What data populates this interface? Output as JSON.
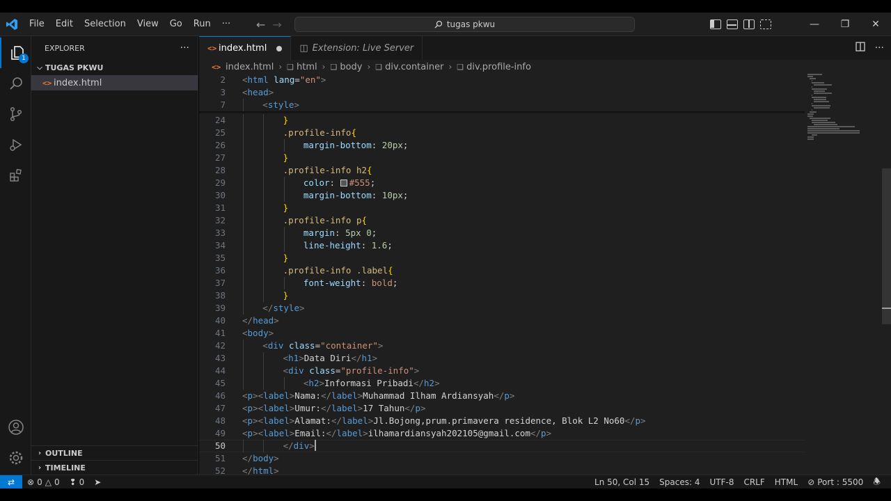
{
  "menu": [
    "File",
    "Edit",
    "Selection",
    "View",
    "Go",
    "Run",
    "···"
  ],
  "command_center": "tugas pkwu",
  "explorer": {
    "title": "EXPLORER",
    "folder": "TUGAS PKWU",
    "file": "index.html",
    "outline": "OUTLINE",
    "timeline": "TIMELINE",
    "badge": "1"
  },
  "tabs": [
    {
      "label": "index.html",
      "icon": "<>",
      "dirty": true
    },
    {
      "label": "Extension: Live Server"
    }
  ],
  "breadcrumbs": [
    "index.html",
    "html",
    "body",
    "div.container",
    "div.profile-info"
  ],
  "code": {
    "sticky": [
      {
        "n": "2",
        "indent": 0,
        "toks": [
          [
            "br",
            "<"
          ],
          [
            "tag",
            "html"
          ],
          [
            "txt",
            " "
          ],
          [
            "attr",
            "lang"
          ],
          [
            "txt",
            "="
          ],
          [
            "str",
            "\"en\""
          ],
          [
            "br",
            ">"
          ]
        ]
      },
      {
        "n": "3",
        "indent": 0,
        "toks": [
          [
            "br",
            "<"
          ],
          [
            "tag",
            "head"
          ],
          [
            "br",
            ">"
          ]
        ]
      },
      {
        "n": "7",
        "indent": 1,
        "toks": [
          [
            "br",
            "<"
          ],
          [
            "tag",
            "style"
          ],
          [
            "br",
            ">"
          ]
        ]
      }
    ],
    "lines": [
      {
        "n": "24",
        "indent": 2,
        "toks": [
          [
            "y",
            "}"
          ]
        ]
      },
      {
        "n": "25",
        "indent": 2,
        "toks": [
          [
            "sel",
            ".profile-info"
          ],
          [
            "y",
            "{"
          ]
        ]
      },
      {
        "n": "26",
        "indent": 3,
        "toks": [
          [
            "prop",
            "margin-bottom"
          ],
          [
            "txt",
            ": "
          ],
          [
            "num",
            "20px"
          ],
          [
            "txt",
            ";"
          ]
        ]
      },
      {
        "n": "27",
        "indent": 2,
        "toks": [
          [
            "y",
            "}"
          ]
        ]
      },
      {
        "n": "28",
        "indent": 2,
        "toks": [
          [
            "sel",
            ".profile-info h2"
          ],
          [
            "y",
            "{"
          ]
        ]
      },
      {
        "n": "29",
        "indent": 3,
        "toks": [
          [
            "prop",
            "color"
          ],
          [
            "txt",
            ": "
          ],
          [
            "swatch",
            ""
          ],
          [
            "str",
            "#555"
          ],
          [
            "txt",
            ";"
          ]
        ]
      },
      {
        "n": "30",
        "indent": 3,
        "toks": [
          [
            "prop",
            "margin-bottom"
          ],
          [
            "txt",
            ": "
          ],
          [
            "num",
            "10px"
          ],
          [
            "txt",
            ";"
          ]
        ]
      },
      {
        "n": "31",
        "indent": 2,
        "toks": [
          [
            "y",
            "}"
          ]
        ]
      },
      {
        "n": "32",
        "indent": 2,
        "toks": [
          [
            "sel",
            ".profile-info p"
          ],
          [
            "y",
            "{"
          ]
        ]
      },
      {
        "n": "33",
        "indent": 3,
        "toks": [
          [
            "prop",
            "margin"
          ],
          [
            "txt",
            ": "
          ],
          [
            "num",
            "5px"
          ],
          [
            "txt",
            " "
          ],
          [
            "num",
            "0"
          ],
          [
            "txt",
            ";"
          ]
        ]
      },
      {
        "n": "34",
        "indent": 3,
        "toks": [
          [
            "prop",
            "line-height"
          ],
          [
            "txt",
            ": "
          ],
          [
            "num",
            "1.6"
          ],
          [
            "txt",
            ";"
          ]
        ]
      },
      {
        "n": "35",
        "indent": 2,
        "toks": [
          [
            "y",
            "}"
          ]
        ]
      },
      {
        "n": "36",
        "indent": 2,
        "toks": [
          [
            "sel",
            ".profile-info .label"
          ],
          [
            "y",
            "{"
          ]
        ]
      },
      {
        "n": "37",
        "indent": 3,
        "toks": [
          [
            "prop",
            "font-weight"
          ],
          [
            "txt",
            ": "
          ],
          [
            "str",
            "bold"
          ],
          [
            "txt",
            ";"
          ]
        ]
      },
      {
        "n": "38",
        "indent": 2,
        "toks": [
          [
            "y",
            "}"
          ]
        ]
      },
      {
        "n": "39",
        "indent": 1,
        "toks": [
          [
            "br",
            "</"
          ],
          [
            "tag",
            "style"
          ],
          [
            "br",
            ">"
          ]
        ]
      },
      {
        "n": "40",
        "indent": 0,
        "toks": [
          [
            "br",
            "</"
          ],
          [
            "tag",
            "head"
          ],
          [
            "br",
            ">"
          ]
        ]
      },
      {
        "n": "41",
        "indent": 0,
        "toks": [
          [
            "br",
            "<"
          ],
          [
            "tag",
            "body"
          ],
          [
            "br",
            ">"
          ]
        ]
      },
      {
        "n": "42",
        "indent": 1,
        "toks": [
          [
            "br",
            "<"
          ],
          [
            "tag",
            "div"
          ],
          [
            "txt",
            " "
          ],
          [
            "attr",
            "class"
          ],
          [
            "txt",
            "="
          ],
          [
            "str",
            "\"container\""
          ],
          [
            "br",
            ">"
          ]
        ]
      },
      {
        "n": "43",
        "indent": 2,
        "toks": [
          [
            "br",
            "<"
          ],
          [
            "tag",
            "h1"
          ],
          [
            "br",
            ">"
          ],
          [
            "txt",
            "Data Diri"
          ],
          [
            "br",
            "</"
          ],
          [
            "tag",
            "h1"
          ],
          [
            "br",
            ">"
          ]
        ]
      },
      {
        "n": "44",
        "indent": 2,
        "toks": [
          [
            "br",
            "<"
          ],
          [
            "tag",
            "div"
          ],
          [
            "txt",
            " "
          ],
          [
            "attr",
            "class"
          ],
          [
            "txt",
            "="
          ],
          [
            "str",
            "\"profile-info\""
          ],
          [
            "br",
            ">"
          ]
        ]
      },
      {
        "n": "45",
        "indent": 3,
        "toks": [
          [
            "br",
            "<"
          ],
          [
            "tag",
            "h2"
          ],
          [
            "br",
            ">"
          ],
          [
            "txt",
            "Informasi Pribadi"
          ],
          [
            "br",
            "</"
          ],
          [
            "tag",
            "h2"
          ],
          [
            "br",
            ">"
          ]
        ]
      },
      {
        "n": "46",
        "indent": 0,
        "toks": [
          [
            "br",
            "<"
          ],
          [
            "tag",
            "p"
          ],
          [
            "br",
            "><"
          ],
          [
            "tag",
            "label"
          ],
          [
            "br",
            ">"
          ],
          [
            "txt",
            "Nama:"
          ],
          [
            "br",
            "</"
          ],
          [
            "tag",
            "label"
          ],
          [
            "br",
            ">"
          ],
          [
            "txt",
            "Muhammad Ilham Ardiansyah"
          ],
          [
            "br",
            "</"
          ],
          [
            "tag",
            "p"
          ],
          [
            "br",
            ">"
          ]
        ]
      },
      {
        "n": "47",
        "indent": 0,
        "toks": [
          [
            "br",
            "<"
          ],
          [
            "tag",
            "p"
          ],
          [
            "br",
            "><"
          ],
          [
            "tag",
            "label"
          ],
          [
            "br",
            ">"
          ],
          [
            "txt",
            "Umur:"
          ],
          [
            "br",
            "</"
          ],
          [
            "tag",
            "label"
          ],
          [
            "br",
            ">"
          ],
          [
            "txt",
            "17 Tahun"
          ],
          [
            "br",
            "</"
          ],
          [
            "tag",
            "p"
          ],
          [
            "br",
            ">"
          ]
        ]
      },
      {
        "n": "48",
        "indent": 0,
        "toks": [
          [
            "br",
            "<"
          ],
          [
            "tag",
            "p"
          ],
          [
            "br",
            "><"
          ],
          [
            "tag",
            "label"
          ],
          [
            "br",
            ">"
          ],
          [
            "txt",
            "Alamat:"
          ],
          [
            "br",
            "</"
          ],
          [
            "tag",
            "label"
          ],
          [
            "br",
            ">"
          ],
          [
            "txt",
            "Jl.Bojong,prum.primavera residence, Blok L2 No60"
          ],
          [
            "br",
            "</"
          ],
          [
            "tag",
            "p"
          ],
          [
            "br",
            ">"
          ]
        ]
      },
      {
        "n": "49",
        "indent": 0,
        "toks": [
          [
            "br",
            "<"
          ],
          [
            "tag",
            "p"
          ],
          [
            "br",
            "><"
          ],
          [
            "tag",
            "label"
          ],
          [
            "br",
            ">"
          ],
          [
            "txt",
            "Email:"
          ],
          [
            "br",
            "</"
          ],
          [
            "tag",
            "label"
          ],
          [
            "br",
            ">"
          ],
          [
            "txt",
            "ilhamardiansyah202105@gmail.com"
          ],
          [
            "br",
            "</"
          ],
          [
            "tag",
            "p"
          ],
          [
            "br",
            ">"
          ]
        ]
      },
      {
        "n": "50",
        "indent": 2,
        "toks": [
          [
            "br",
            "</"
          ],
          [
            "tag",
            "div"
          ],
          [
            "br",
            ">"
          ],
          [
            "cursor",
            ""
          ]
        ],
        "current": true
      },
      {
        "n": "51",
        "indent": 0,
        "toks": [
          [
            "br",
            "</"
          ],
          [
            "tag",
            "body"
          ],
          [
            "br",
            ">"
          ]
        ]
      },
      {
        "n": "52",
        "indent": 0,
        "toks": [
          [
            "br",
            "</"
          ],
          [
            "tag",
            "html"
          ],
          [
            "br",
            ">"
          ]
        ]
      }
    ]
  },
  "status": {
    "errors": "0",
    "warnings": "0",
    "ports": "0",
    "position": "Ln 50, Col 15",
    "spaces": "Spaces: 4",
    "encoding": "UTF-8",
    "eol": "CRLF",
    "language": "HTML",
    "port": "Port : 5500"
  },
  "colors": {
    "accent": "#0078d4",
    "editor_bg": "#1f1f1f",
    "sidebar_bg": "#181818",
    "html_icon": "#e37933"
  },
  "icons": [
    "vscode-logo-icon",
    "files-icon",
    "search-icon",
    "source-control-icon",
    "run-debug-icon",
    "extensions-icon",
    "account-icon",
    "settings-gear-icon",
    "split-editor-icon",
    "more-actions-icon",
    "bell-icon"
  ]
}
